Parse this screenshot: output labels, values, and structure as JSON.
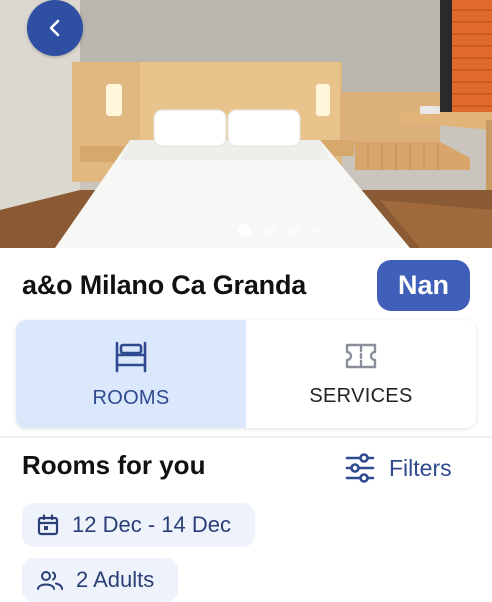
{
  "hotel": {
    "name": "a&o Milano Ca Granda",
    "rating_label": "Nan"
  },
  "gallery": {
    "dot_count": 4,
    "active_index": 0
  },
  "tabs": [
    {
      "label": "ROOMS",
      "icon": "bed-icon",
      "active": true
    },
    {
      "label": "SERVICES",
      "icon": "ticket-icon",
      "active": false
    }
  ],
  "rooms": {
    "title": "Rooms for you",
    "filters_label": "Filters",
    "dates": "12 Dec - 14 Dec",
    "guests": "2 Adults"
  },
  "colors": {
    "primary": "#2f4fa3",
    "badge": "#3f5fb8",
    "tab_active_bg": "#dbe8fb",
    "chip_bg": "#eef3fb"
  }
}
